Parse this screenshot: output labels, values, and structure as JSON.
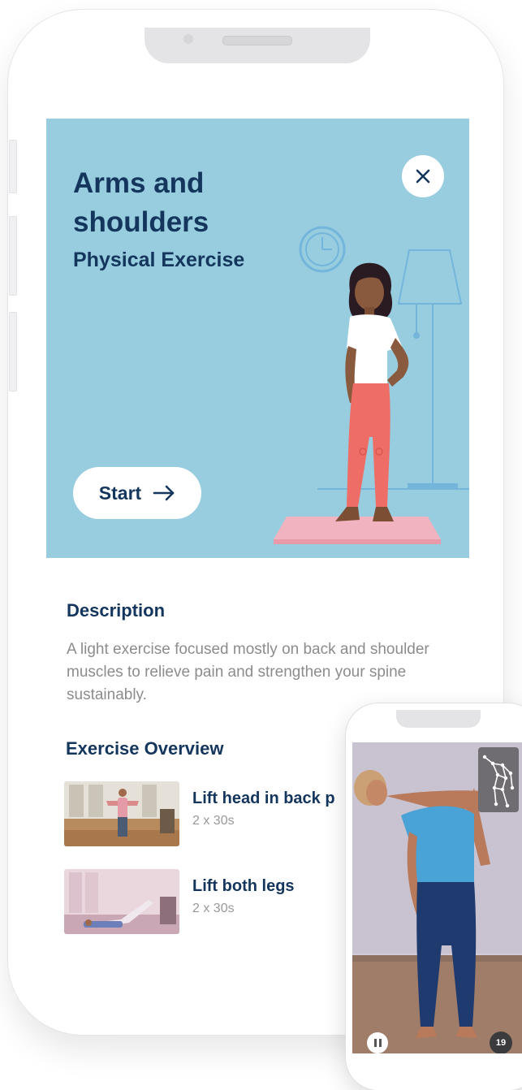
{
  "hero": {
    "title": "Arms and shoulders",
    "subtitle": "Physical Exercise",
    "start_label": "Start",
    "background_color": "#98cde0",
    "icons": {
      "close": "close-icon",
      "start": "arrow-right-icon"
    }
  },
  "description": {
    "heading": "Description",
    "text": "A light exercise focused mostly on back and shoulder muscles to relieve pain and strengthen your spine sustainably."
  },
  "overview": {
    "heading": "Exercise Overview",
    "items": [
      {
        "name": "Lift head in back p",
        "sets": "2 x 30s"
      },
      {
        "name": "Lift both legs",
        "sets": "2 x 30s"
      }
    ]
  },
  "video_player": {
    "counter": "19",
    "icons": {
      "pose": "pose-skeleton-icon",
      "pause": "pause-icon"
    }
  },
  "colors": {
    "navy_text": "#14365d",
    "muted_text": "#8c8c8c",
    "mat_pink": "#f0b3bf",
    "pants_coral": "#ee6e67"
  }
}
